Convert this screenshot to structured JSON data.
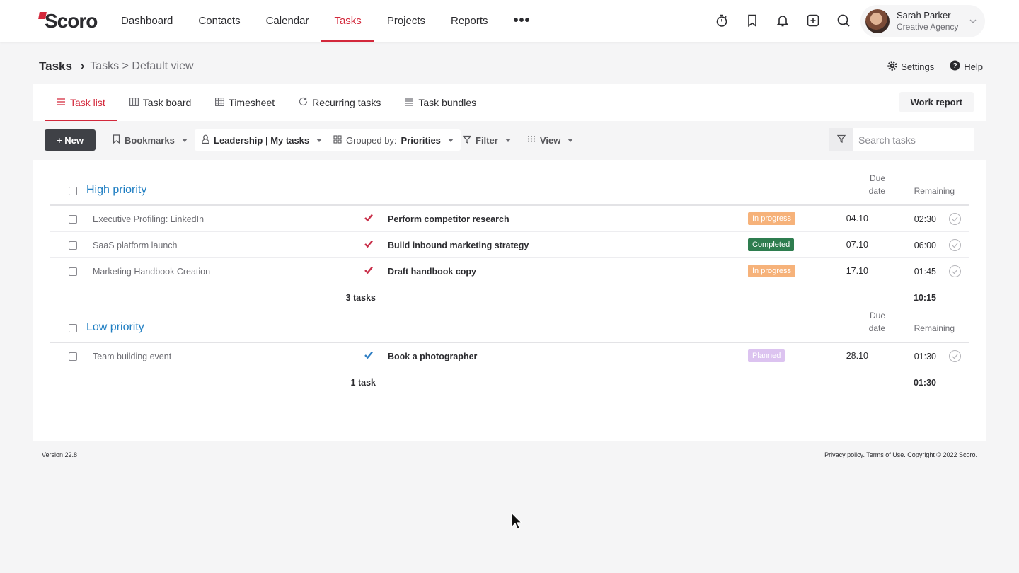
{
  "brand": {
    "logo_text": "Scoro",
    "accent_color": "#d3283b"
  },
  "nav": {
    "items": [
      {
        "label": "Dashboard",
        "active": false
      },
      {
        "label": "Contacts",
        "active": false
      },
      {
        "label": "Calendar",
        "active": false
      },
      {
        "label": "Tasks",
        "active": true
      },
      {
        "label": "Projects",
        "active": false
      },
      {
        "label": "Reports",
        "active": false
      }
    ],
    "more_label": "•••",
    "icons": [
      "timer-icon",
      "bookmark-icon",
      "bell-icon",
      "add-square-icon",
      "search-icon"
    ]
  },
  "user": {
    "name": "Sarah Parker",
    "company": "Creative Agency"
  },
  "header": {
    "title": "Tasks",
    "separator": "›",
    "path": "Tasks > Default view",
    "settings_label": "Settings",
    "help_label": "Help"
  },
  "tabs": [
    {
      "label": "Task list",
      "icon": "list-icon",
      "active": true
    },
    {
      "label": "Task board",
      "icon": "board-icon",
      "active": false
    },
    {
      "label": "Timesheet",
      "icon": "grid-icon",
      "active": false
    },
    {
      "label": "Recurring tasks",
      "icon": "refresh-icon",
      "active": false
    },
    {
      "label": "Task bundles",
      "icon": "stack-icon",
      "active": false
    }
  ],
  "work_report_label": "Work report",
  "toolbar": {
    "new_label": "+ New",
    "bookmarks_label": "Bookmarks",
    "scope_label": "Leadership | My tasks",
    "grouped_prefix": "Grouped by:",
    "grouped_value": "Priorities",
    "filter_label": "Filter",
    "view_label": "View",
    "search_placeholder": "Search tasks"
  },
  "columns": {
    "due_line1": "Due",
    "due_line2": "date",
    "remaining": "Remaining"
  },
  "groups": [
    {
      "title": "High priority",
      "rows": [
        {
          "project": "Executive Profiling: LinkedIn",
          "priority_color": "#c9304a",
          "task": "Perform competitor research",
          "status": "In progress",
          "status_color": "#f6b27a",
          "due": "04.10",
          "remaining": "02:30"
        },
        {
          "project": "SaaS platform launch",
          "priority_color": "#c9304a",
          "task": "Build inbound marketing strategy",
          "status": "Completed",
          "status_color": "#2e7d4f",
          "due": "07.10",
          "remaining": "06:00"
        },
        {
          "project": "Marketing Handbook Creation",
          "priority_color": "#c9304a",
          "task": "Draft handbook copy",
          "status": "In progress",
          "status_color": "#f6b27a",
          "due": "17.10",
          "remaining": "01:45"
        }
      ],
      "count_label": "3 tasks",
      "total": "10:15"
    },
    {
      "title": "Low priority",
      "rows": [
        {
          "project": "Team building event",
          "priority_color": "#2f7fc4",
          "task": "Book a photographer",
          "status": "Planned",
          "status_color": "#dcc3f0",
          "due": "28.10",
          "remaining": "01:30"
        }
      ],
      "count_label": "1 task",
      "total": "01:30"
    }
  ],
  "footer": {
    "version": "Version 22.8",
    "legal": "Privacy policy. Terms of Use. Copyright © 2022 Scoro."
  }
}
